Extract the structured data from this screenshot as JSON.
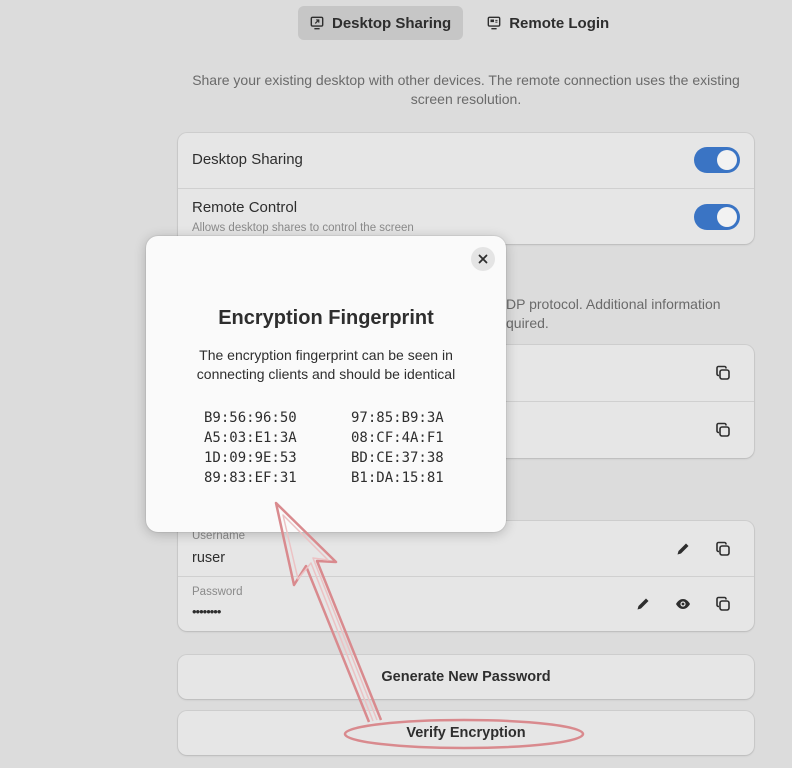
{
  "tabs": [
    {
      "label": "Desktop Sharing",
      "icon": "desktop-share-icon",
      "active": true
    },
    {
      "label": "Remote Login",
      "icon": "remote-login-icon",
      "active": false
    }
  ],
  "intro_text": "Share your existing desktop with other devices. The remote connection uses the existing screen resolution.",
  "sharing_card": {
    "desktop_sharing": {
      "label": "Desktop Sharing",
      "enabled": true
    },
    "remote_control": {
      "label": "Remote Control",
      "subtitle": "Allows desktop shares to control the screen",
      "enabled": true
    }
  },
  "protocol_text_visible": "DP protocol. Additional information",
  "protocol_text_visible2": "quired.",
  "login": {
    "username_label": "Username",
    "username_value": "ruser",
    "password_label": "Password",
    "password_value": "••••••••"
  },
  "buttons": {
    "generate": "Generate New Password",
    "verify": "Verify Encryption"
  },
  "dialog": {
    "title": "Encryption Fingerprint",
    "body": "The encryption fingerprint can be seen in connecting clients and should be identical",
    "fingerprint": [
      "B9:56:96:50",
      "97:85:B9:3A",
      "A5:03:E1:3A",
      "08:CF:4A:F1",
      "1D:09:9E:53",
      "BD:CE:37:38",
      "89:83:EF:31",
      "B1:DA:15:81"
    ]
  },
  "colors": {
    "accent": "#3a74c4",
    "annotation": "#d98a8e"
  }
}
